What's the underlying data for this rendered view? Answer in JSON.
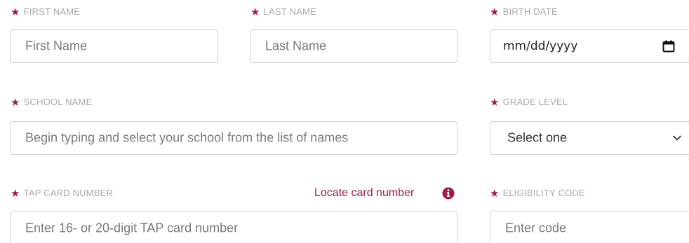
{
  "required_mark": "★",
  "first_name": {
    "label": "FIRST NAME",
    "placeholder": "First Name"
  },
  "last_name": {
    "label": "LAST NAME",
    "placeholder": "Last Name"
  },
  "birth_date": {
    "label": "BIRTH DATE",
    "value": "mm/dd/yyyy",
    "icon": "calendar-icon"
  },
  "school_name": {
    "label": "SCHOOL NAME",
    "placeholder": "Begin typing and select your school from the list of names"
  },
  "grade_level": {
    "label": "GRADE LEVEL",
    "value": "Select one",
    "icon": "chevron-down-icon"
  },
  "tap_card": {
    "label": "TAP CARD NUMBER",
    "placeholder": "Enter 16- or 20-digit TAP card number",
    "locate_link": "Locate card number",
    "icon": "info-icon"
  },
  "eligibility_code": {
    "label": "ELIGIBILITY CODE",
    "placeholder": "Enter code"
  },
  "colors": {
    "accent": "#a3194f",
    "label": "#a8a8a8",
    "border": "#cfcfcf",
    "placeholder": "#7a7a7a"
  }
}
